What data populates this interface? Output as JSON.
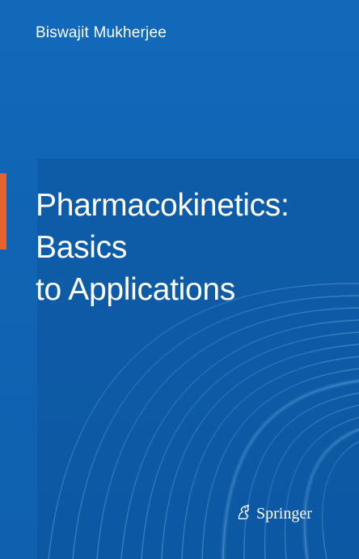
{
  "cover": {
    "author": "Biswajit Mukherjee",
    "title_lines": [
      "Pharmacokinetics:",
      "Basics",
      "to Applications"
    ],
    "publisher": "Springer",
    "publisher_logo_icon": "springer-horse-icon",
    "colors": {
      "background": "#0f60b0",
      "accent": "#e8632b",
      "text": "#ffffff"
    }
  }
}
